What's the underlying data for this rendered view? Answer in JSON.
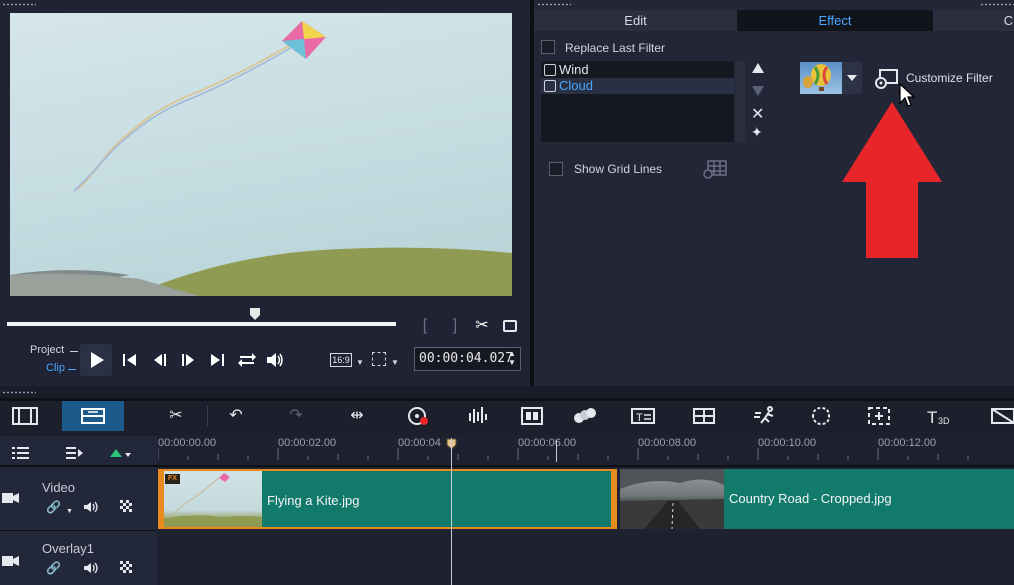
{
  "preview": {
    "mode_project": "Project",
    "mode_clip": "Clip",
    "aspect_ratio": "16:9",
    "timecode": "00:00:04.027"
  },
  "options": {
    "tabs": [
      "Edit",
      "Effect",
      "C"
    ],
    "active_tab": "Effect",
    "replace_last_filter_label": "Replace Last Filter",
    "filters": [
      "Wind",
      "Cloud"
    ],
    "selected_filter": "Cloud",
    "customize_filter_label": "Customize Filter",
    "show_grid_lines_label": "Show Grid Lines"
  },
  "timeline": {
    "ruler_labels": [
      "00:00:00.00",
      "00:00:02.00",
      "00:00:04",
      "00:00:06.00",
      "00:00:08.00",
      "00:00:10.00",
      "00:00:12.00"
    ],
    "tracks": [
      {
        "name": "Video"
      },
      {
        "name": "Overlay1"
      }
    ],
    "clips": [
      {
        "label": "Flying a Kite.jpg",
        "badge": "FX"
      },
      {
        "label": "Country Road - Cropped.jpg"
      }
    ]
  },
  "colors": {
    "accent": "#4aa6ff",
    "clip": "#127a6a",
    "selection_border": "#e88a1e",
    "annotation_arrow": "#e8262a"
  }
}
